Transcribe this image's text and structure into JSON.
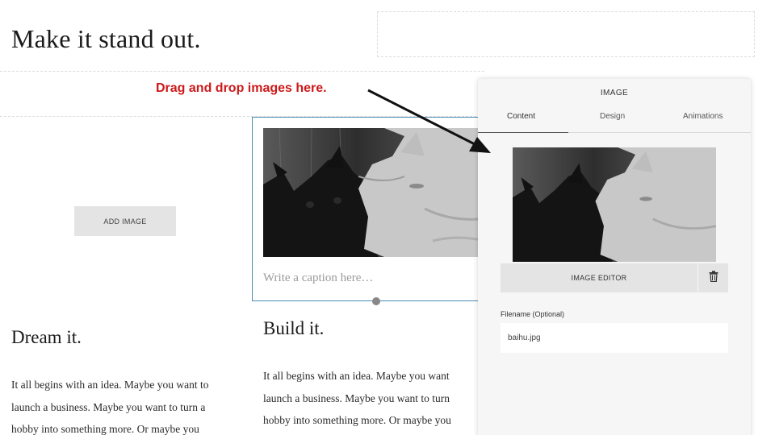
{
  "page": {
    "hero_title": "Make it stand out.",
    "add_image_label": "ADD IMAGE",
    "caption_placeholder": "Write a caption here…",
    "annotation": "Drag and drop images here.",
    "annotation_color": "#cc1a1a",
    "selection_color": "#4a8bb5"
  },
  "columns": [
    {
      "title": "Dream it.",
      "lines": [
        "It all begins with an idea. Maybe you want to",
        "launch a business. Maybe you want to turn a",
        "hobby into something more. Or maybe you"
      ]
    },
    {
      "title": "Build it.",
      "lines": [
        "It all begins with an idea. Maybe you want",
        "launch a business. Maybe you want to turn",
        "hobby into something more. Or maybe you"
      ]
    }
  ],
  "panel": {
    "title": "IMAGE",
    "tabs": [
      {
        "label": "Content",
        "active": true
      },
      {
        "label": "Design",
        "active": false
      },
      {
        "label": "Animations",
        "active": false
      }
    ],
    "image_editor_label": "IMAGE EDITOR",
    "delete_icon": "trash-icon",
    "filename_label": "Filename (Optional)",
    "filename_value": "baihu.jpg"
  }
}
